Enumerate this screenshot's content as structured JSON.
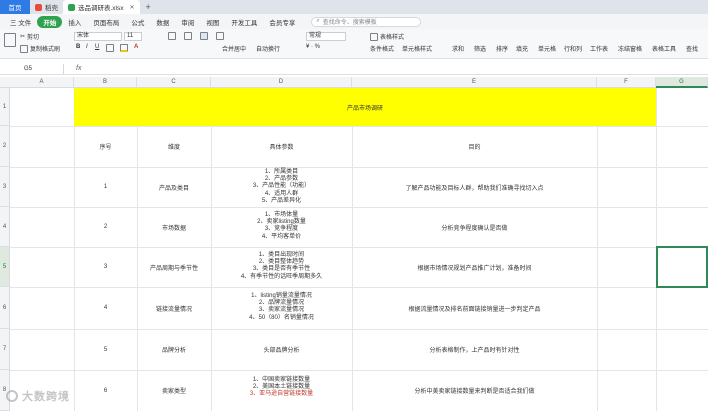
{
  "tabs": [
    {
      "label": "首页"
    },
    {
      "label": "稻壳"
    },
    {
      "label": "选品调研表.xlsx"
    }
  ],
  "menu": [
    "三 文件",
    "开始",
    "插入",
    "页面布局",
    "公式",
    "数据",
    "审阅",
    "视图",
    "开发工具",
    "会员专享"
  ],
  "search_placeholder": "查找命令、搜索模板",
  "ribbon": {
    "cut": "剪切",
    "copy": "复制",
    "format_painter": "格式刷",
    "paste": "粘贴",
    "font_name": "宋体",
    "font_size": "11",
    "merge_center": "合并居中",
    "auto_wrap": "自动换行",
    "number_format": "常规",
    "table_style": "表格样式",
    "conditional_format": "条件格式",
    "cell_style": "单元格样式",
    "sum": "求和",
    "filter": "筛选",
    "sort": "排序",
    "fill": "填充",
    "cell": "单元格",
    "rowcol": "行和列",
    "worksheet": "工作表",
    "freeze": "冻结窗格",
    "table_tools": "表格工具",
    "find": "查找"
  },
  "formula_bar": {
    "name_box": "G5",
    "fx": "fx",
    "value": ""
  },
  "columns": [
    "A",
    "B",
    "C",
    "D",
    "E",
    "F",
    "G"
  ],
  "selected_column": "G",
  "rows": [
    "1",
    "2",
    "3",
    "4",
    "5",
    "6",
    "7",
    "8"
  ],
  "selected_row": "5",
  "sheet": {
    "title": "产品市场调研",
    "headers": {
      "seq": "序号",
      "dimension": "维度",
      "params": "具体参数",
      "purpose": "目的"
    },
    "records": [
      {
        "seq": "1",
        "dimension": "产品及类目",
        "params": [
          "1、所属类目",
          "2、产品参数",
          "3、产品性能（功能）",
          "4、适用人群",
          "5、产品差异化"
        ],
        "purpose": "了解产品功能及目标人群，帮助我们准确寻找切入点"
      },
      {
        "seq": "2",
        "dimension": "市场数据",
        "params": [
          "1、市场体量",
          "2、卖家listing数量",
          "3、竞争程度",
          "4、平均客单价"
        ],
        "purpose": "分析竞争程度确认是否做"
      },
      {
        "seq": "3",
        "dimension": "产品周期与季节性",
        "params": [
          "1、类目出现时间",
          "2、类目整体趋势",
          "3、类目是否有季节性",
          "4、有季节性的话旺季周期多久"
        ],
        "purpose": "根据市场情况规划产品推广计划，准备时间"
      },
      {
        "seq": "4",
        "dimension": "链接流量情况",
        "params": [
          "1、listing销量流量情况",
          "2、品牌流量情况",
          "3、卖家流量情况",
          "4、50（80）名销量情况"
        ],
        "purpose": "根据流量情况及排名前面链接销量进一步判定产品"
      },
      {
        "seq": "5",
        "dimension": "品牌分析",
        "params": [
          "头部品牌分析"
        ],
        "purpose": "分析表格制作，上产品时有针对性"
      },
      {
        "seq": "6",
        "dimension": "卖家类型",
        "params": [
          "1、中国卖家链接数量",
          "2、美国本土链接数量",
          "3、亚马逊自营链接数量"
        ],
        "purpose": "分析中美卖家链接数量来判断是否适合我们做"
      }
    ]
  },
  "watermark": "大数跨境",
  "colors": {
    "banner": "#ffff00",
    "accent": "#2e8b57",
    "home_tab": "#2f7be6",
    "menu_selected": "#2fa24f"
  }
}
